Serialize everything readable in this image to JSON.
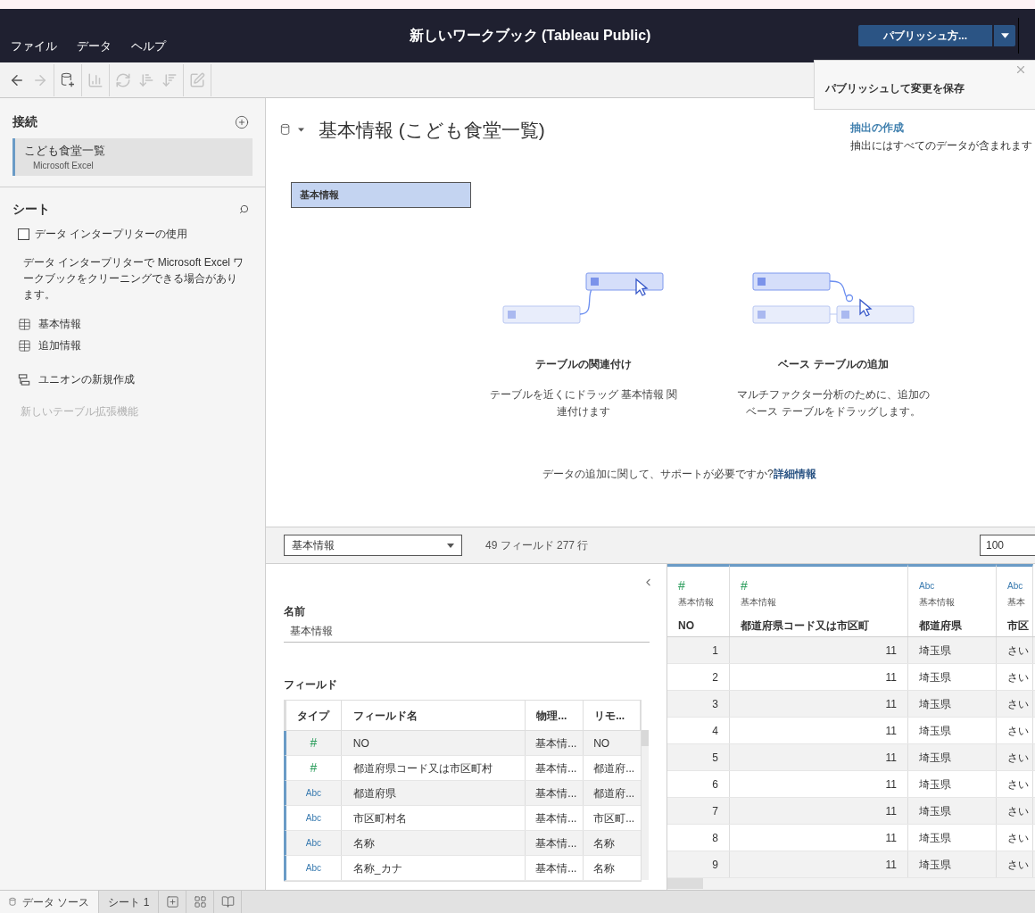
{
  "window": {
    "title": "新しいワークブック (Tableau Public)"
  },
  "menu": [
    "ファイル",
    "データ",
    "ヘルプ"
  ],
  "publish": {
    "label": "パブリッシュ方...",
    "tooltip": "パブリッシュして変更を保存"
  },
  "toolbar_groups": [
    {
      "tools": [
        {
          "kind": "back",
          "disabled": false
        },
        {
          "kind": "forward",
          "disabled": true
        }
      ]
    },
    {
      "tools": [
        {
          "kind": "add-data",
          "disabled": false
        }
      ]
    },
    {
      "tools": [
        {
          "kind": "chart",
          "disabled": true
        }
      ]
    },
    {
      "tools": [
        {
          "kind": "swap",
          "disabled": true
        },
        {
          "kind": "sort-asc",
          "disabled": true
        },
        {
          "kind": "sort-desc",
          "disabled": true
        }
      ]
    },
    {
      "tools": [
        {
          "kind": "pen",
          "disabled": true
        }
      ]
    }
  ],
  "sidebar": {
    "connections_title": "接続",
    "connections": [
      {
        "name": "こども食堂一覧",
        "type": "Microsoft Excel",
        "selected": true
      }
    ],
    "sheets_title": "シート",
    "interpreter": {
      "label": "データ インタープリターの使用",
      "checked": false
    },
    "interpreter_note": "データ インタープリターで Microsoft Excel ワークブックをクリーニングできる場合があります。",
    "items": [
      {
        "kind": "table",
        "label": "基本情報",
        "disabled": false
      },
      {
        "kind": "table",
        "label": "追加情報",
        "disabled": false
      },
      {
        "kind": "union",
        "label": "ユニオンの新規作成",
        "disabled": false
      },
      {
        "kind": "extension",
        "label": "新しいテーブル拡張機能",
        "disabled": true
      }
    ]
  },
  "canvas": {
    "title": "基本情報 (こども食堂一覧)",
    "extract_link": "抽出の作成",
    "extract_note": "抽出にはすべてのデータが含まれます",
    "table_pill": "基本情報",
    "hints": [
      {
        "kind": "relate",
        "title": "テーブルの関連付け",
        "text": "テーブルを近くにドラッグ 基本情報 関連付けます"
      },
      {
        "kind": "base",
        "title": "ベース テーブルの追加",
        "text": "マルチファクター分析のために、追加のベース テーブルをドラッグします。"
      }
    ],
    "help_text": "データの追加に関して、サポートが必要ですか?",
    "help_link": "詳細情報"
  },
  "data_bar": {
    "table_select": "基本情報",
    "counts": "49 フィールド 277 行",
    "rows_field": "100"
  },
  "metadata": {
    "name_label": "名前",
    "name_value": "基本情報",
    "fields_label": "フィールド",
    "columns": [
      "タイプ",
      "フィールド名",
      "物理...",
      "リモ..."
    ],
    "rows": [
      {
        "kind": "number",
        "type": "#",
        "name": "NO",
        "physical": "基本情...",
        "remote": "NO"
      },
      {
        "kind": "number",
        "type": "#",
        "name": "都道府県コード又は市区町村",
        "physical": "基本情...",
        "remote": "都道府..."
      },
      {
        "kind": "string",
        "type": "Abc",
        "name": "都道府県",
        "physical": "基本情...",
        "remote": "都道府..."
      },
      {
        "kind": "string",
        "type": "Abc",
        "name": "市区町村名",
        "physical": "基本情...",
        "remote": "市区町..."
      },
      {
        "kind": "string",
        "type": "Abc",
        "name": "名称",
        "physical": "基本情...",
        "remote": "名称"
      },
      {
        "kind": "string",
        "type": "Abc",
        "name": "名称_カナ",
        "physical": "基本情...",
        "remote": "名称"
      }
    ]
  },
  "grid": {
    "columns": [
      {
        "kind": "number",
        "type": "#",
        "source": "基本情報",
        "name": "NO"
      },
      {
        "kind": "number",
        "type": "#",
        "source": "基本情報",
        "name": "都道府県コード又は市区町"
      },
      {
        "kind": "string",
        "type": "Abc",
        "source": "基本情報",
        "name": "都道府県"
      },
      {
        "kind": "string",
        "type": "Abc",
        "source": "基本",
        "name": "市区"
      }
    ],
    "rows": [
      [
        "1",
        "11",
        "埼玉県",
        "さい"
      ],
      [
        "2",
        "11",
        "埼玉県",
        "さい"
      ],
      [
        "3",
        "11",
        "埼玉県",
        "さい"
      ],
      [
        "4",
        "11",
        "埼玉県",
        "さい"
      ],
      [
        "5",
        "11",
        "埼玉県",
        "さい"
      ],
      [
        "6",
        "11",
        "埼玉県",
        "さい"
      ],
      [
        "7",
        "11",
        "埼玉県",
        "さい"
      ],
      [
        "8",
        "11",
        "埼玉県",
        "さい"
      ],
      [
        "9",
        "11",
        "埼玉県",
        "さい"
      ]
    ]
  },
  "bottom_tabs": [
    {
      "kind": "data-source",
      "label": "データ ソース",
      "selected": true
    },
    {
      "kind": "sheet",
      "label": "シート 1",
      "selected": false
    }
  ],
  "bottom_actions": [
    {
      "kind": "new-sheet"
    },
    {
      "kind": "new-dashboard"
    },
    {
      "kind": "new-story"
    }
  ]
}
